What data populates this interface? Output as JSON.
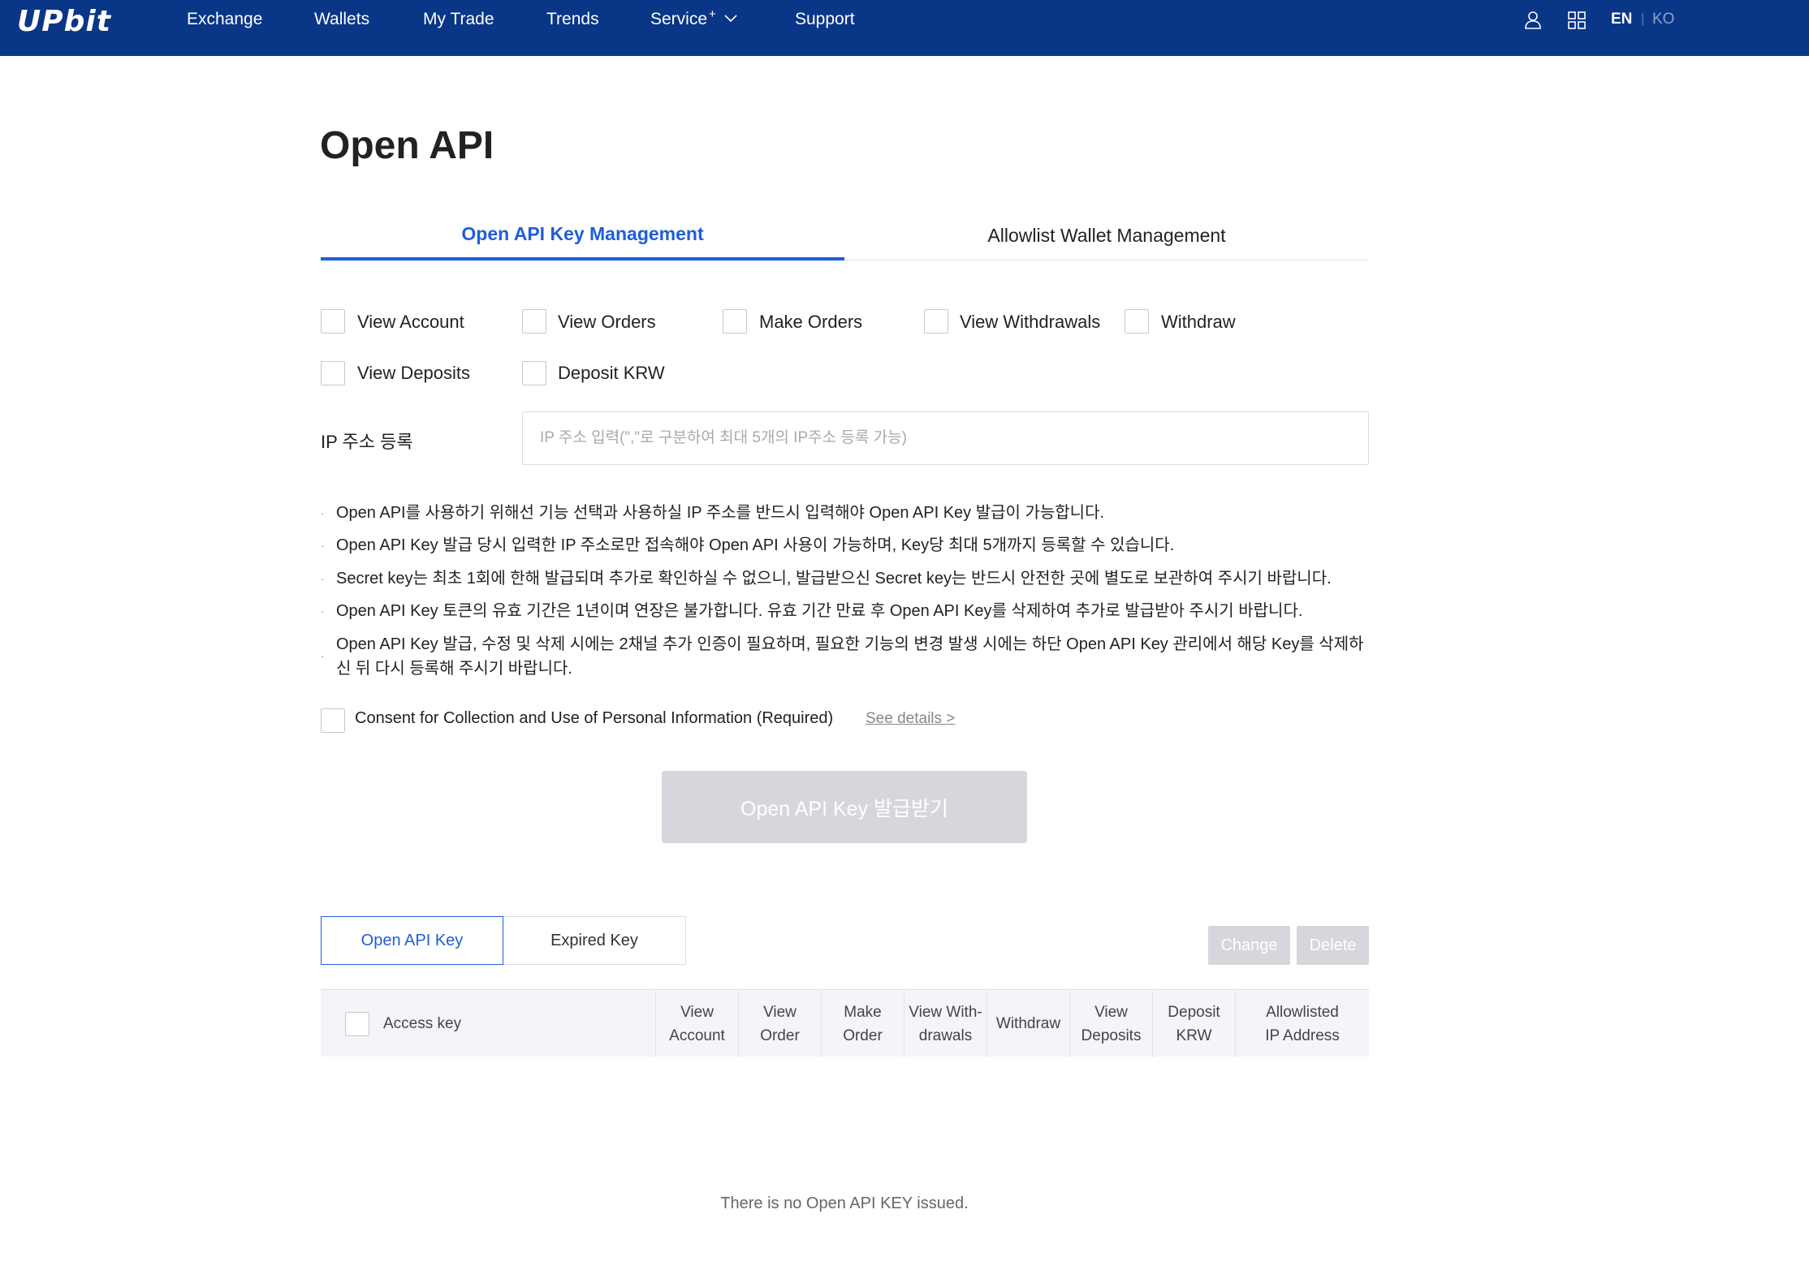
{
  "header": {
    "logo": "UPbit",
    "nav": [
      "Exchange",
      "Wallets",
      "My Trade",
      "Trends",
      "Service",
      "Support"
    ],
    "service_sup": "+",
    "lang_en": "EN",
    "lang_ko": "KO",
    "icons": [
      "user-icon",
      "grid-icon"
    ]
  },
  "page": {
    "title": "Open API"
  },
  "tabs": [
    "Open API Key Management",
    "Allowlist Wallet Management"
  ],
  "permissions": [
    "View Account",
    "View Orders",
    "Make Orders",
    "View Withdrawals",
    "Withdraw",
    "View Deposits",
    "Deposit KRW"
  ],
  "ip": {
    "label": "IP 주소 등록",
    "placeholder": "IP 주소 입력(\",\"로 구분하여 최대 5개의 IP주소 등록 가능)"
  },
  "notices": [
    "Open API를 사용하기 위해선 기능 선택과 사용하실 IP 주소를 반드시 입력해야 Open API Key 발급이 가능합니다.",
    "Open API Key 발급 당시 입력한 IP 주소로만 접속해야 Open API 사용이 가능하며, Key당 최대 5개까지 등록할 수 있습니다.",
    "Secret key는 최초 1회에 한해 발급되며 추가로 확인하실 수 없으니, 발급받으신 Secret key는 반드시 안전한 곳에 별도로 보관하여 주시기 바랍니다.",
    "Open API Key 토큰의 유효 기간은 1년이며 연장은 불가합니다. 유효 기간 만료 후 Open API Key를 삭제하여 추가로 발급받아 주시기 바랍니다.",
    "Open API Key 발급, 수정 및 삭제 시에는 2채널 추가 인증이 필요하며, 필요한 기능의 변경 발생 시에는 하단 Open API Key 관리에서 해당 Key를 삭제하신 뒤 다시 등록해 주시기 바랍니다."
  ],
  "consent": {
    "label": "Consent for Collection and Use of Personal Information (Required)",
    "link": "See details >"
  },
  "issue_button": "Open API Key 발급받기",
  "key_tabs": [
    "Open API Key",
    "Expired Key"
  ],
  "actions": {
    "change": "Change",
    "delete": "Delete"
  },
  "table": {
    "access_key": "Access key",
    "columns": [
      [
        "View",
        "Account"
      ],
      [
        "View",
        "Order"
      ],
      [
        "Make",
        "Order"
      ],
      [
        "View With-",
        "drawals"
      ],
      [
        "Withdraw"
      ],
      [
        "View",
        "Deposits"
      ],
      [
        "Deposit",
        "KRW"
      ],
      [
        "Allowlisted",
        "IP Address"
      ]
    ]
  },
  "empty_message": "There is no Open API KEY issued.",
  "colors": {
    "header_bg": "#093687",
    "accent": "#1f5ed8",
    "disabled_btn": "#d5d7dc"
  }
}
